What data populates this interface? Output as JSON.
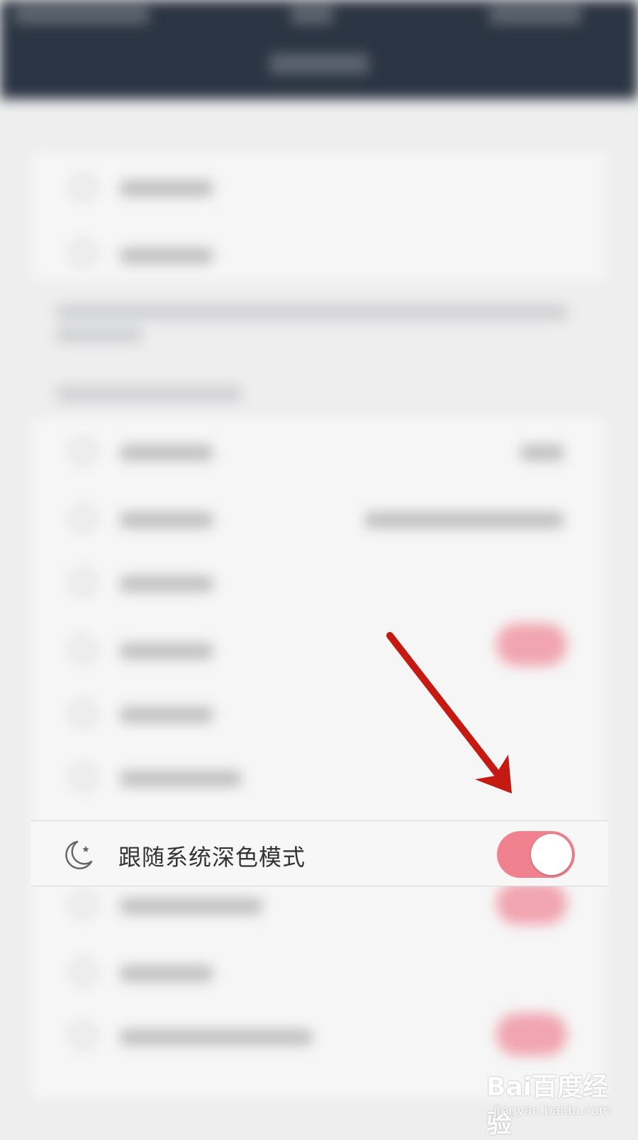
{
  "setting_row": {
    "label": "跟随系统深色模式",
    "icon": "moon-icon",
    "toggle_on": true
  },
  "colors": {
    "toggle_on": "#f0818e",
    "arrow": "#c41a12",
    "header": "#2b3442"
  },
  "watermark": {
    "main": "Bai百度经验",
    "sub": "jingyan.baidu.com"
  }
}
